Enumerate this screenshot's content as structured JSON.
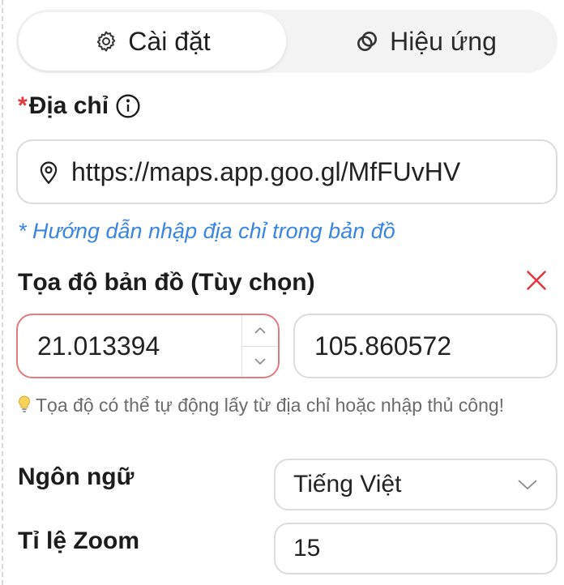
{
  "tabs": [
    {
      "label": "Cài đặt",
      "icon": "gear-icon",
      "active": true
    },
    {
      "label": "Hiệu ứng",
      "icon": "effect-rings-icon",
      "active": false
    }
  ],
  "address": {
    "required_mark": "*",
    "label": "Địa chỉ",
    "value": "https://maps.app.goo.gl/MfFUvHV",
    "hint": "* Hướng dẫn nhập địa chỉ trong bản đồ"
  },
  "coordinates": {
    "label": "Tọa độ bản đồ (Tùy chọn)",
    "latitude": "21.013394",
    "longitude": "105.860572",
    "tip": "Tọa độ có thể tự động lấy từ địa chỉ hoặc nhập thủ công!"
  },
  "language": {
    "label": "Ngôn ngữ",
    "value": "Tiếng Việt"
  },
  "zoom": {
    "label": "Tỉ lệ Zoom",
    "value": "15"
  },
  "colors": {
    "required": "#e0383e",
    "link": "#3a85e0",
    "error_border": "#e07b80"
  }
}
